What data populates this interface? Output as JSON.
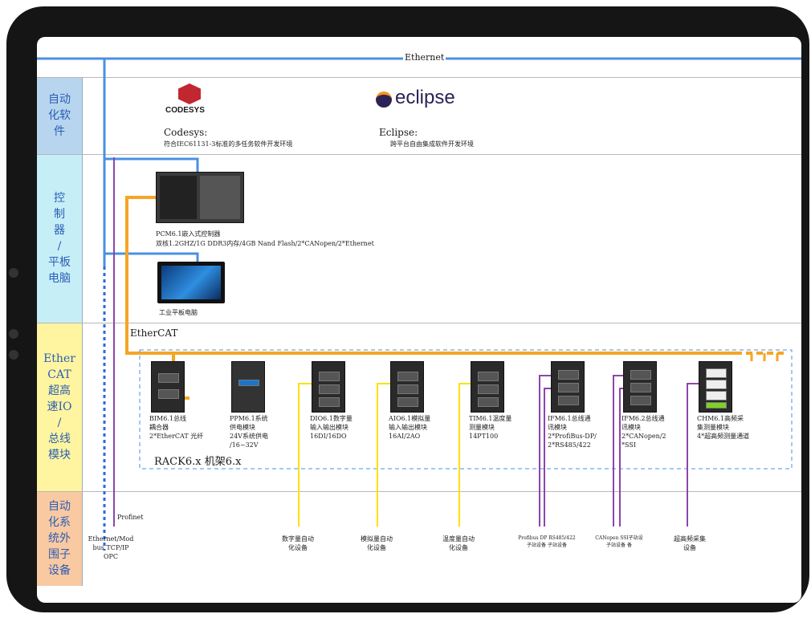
{
  "network": {
    "ethernet": "Ethernet",
    "ethercat": "EtherCAT",
    "profinet": "Profinet"
  },
  "lanes": [
    {
      "label": "自动\n化软\n件",
      "color": "#b7d5ee"
    },
    {
      "label": "控\n制\n器\n/\n平板\n电脑",
      "color": "#c6eef7"
    },
    {
      "label": "Ether\nCAT\n超高\n速IO\n/\n总线\n模块",
      "color": "#fff5a0"
    },
    {
      "label": "自动\n化系\n统外\n围子\n设备",
      "color": "#f9c9a2"
    }
  ],
  "software": {
    "codesys_logo": "CODESYS",
    "codesys_title": "Codesys:",
    "codesys_desc": "符合IEC61131-3标准的多任务软件开发环境",
    "eclipse_logo": "eclipse",
    "eclipse_title": "Eclipse:",
    "eclipse_desc": "跨平台自由集成软件开发环境"
  },
  "controller": {
    "name": "PCM6.1嵌入式控制器",
    "spec": "双核1.2GHZ/1G DDR3内存/4GB Nand Flash/2*CANopen/2*Ethernet",
    "panel": "工业平板电脑"
  },
  "rack": {
    "label": "RACK6.x 机架6.x"
  },
  "modules": [
    {
      "caption": "BIM6.1总线\n耦合器\n2*EtherCAT 光纤"
    },
    {
      "caption": "PPM6.1系统\n供电模块\n24V系统供电\n/16~32V"
    },
    {
      "caption": "DIO6.1数字量\n输入输出模块\n16DI/16DO"
    },
    {
      "caption": "AIO6.1模拟量\n输入输出模块\n16AI/2AO"
    },
    {
      "caption": "TIM6.1温度量\n测量模块\n14PT100"
    },
    {
      "caption": "IFM6.1总线通\n讯模块\n2*ProfiBus-DP/\n2*RS485/422"
    },
    {
      "caption": "IFM6.2总线通\n讯模块\n2*CANopen/2\n*SSI"
    },
    {
      "caption": "CHM6.1高频采\n集测量模块\n4*超高频测量通道"
    }
  ],
  "peripherals": [
    {
      "label": "Ethernet/Mod\nbus TCP/IP\nOPC"
    },
    {
      "label": "数字量自动\n化设备"
    },
    {
      "label": "模拟量自动\n化设备"
    },
    {
      "label": "温度量自动\n化设备"
    },
    {
      "label": "Profibus DP RS485/422\n子站设备    子站设备"
    },
    {
      "label": "CANopen  SSI子站设\n子站设备    备"
    },
    {
      "label": "超高频采集\n设备"
    }
  ],
  "colors": {
    "ethernet": "#4a90e2",
    "ethercat": "#f5a623",
    "analog": "#ffe000",
    "bus": "#8e44ad",
    "lane_text": "#2b5eb5"
  }
}
